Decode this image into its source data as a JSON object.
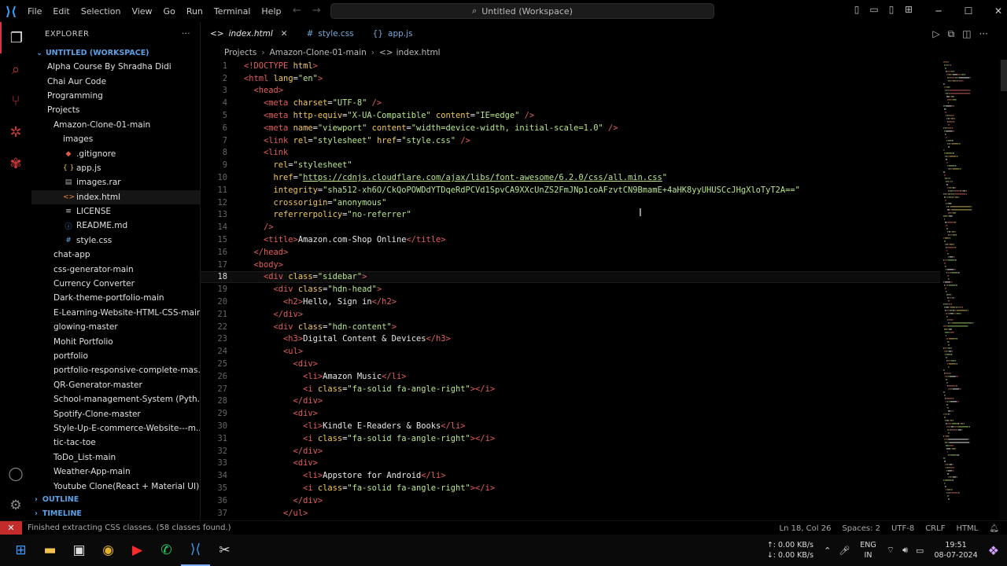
{
  "menu": [
    "File",
    "Edit",
    "Selection",
    "View",
    "Go",
    "Run",
    "Terminal",
    "Help"
  ],
  "command_center": "Untitled (Workspace)",
  "explorer": {
    "title": "EXPLORER",
    "more": "···",
    "workspace": "UNTITLED (WORKSPACE)",
    "items": [
      {
        "label": "Alpha Course By Shradha Didi",
        "indent": 20,
        "icon": "folder"
      },
      {
        "label": "Chai Aur Code",
        "indent": 20,
        "icon": "folder"
      },
      {
        "label": "Programming",
        "indent": 20,
        "icon": "folder"
      },
      {
        "label": "Projects",
        "indent": 20,
        "icon": "folder"
      },
      {
        "label": "Amazon-Clone-01-main",
        "indent": 28,
        "icon": "folder"
      },
      {
        "label": "images",
        "indent": 40,
        "icon": "folder"
      },
      {
        "label": ".gitignore",
        "indent": 40,
        "icon": "git"
      },
      {
        "label": "app.js",
        "indent": 40,
        "icon": "js"
      },
      {
        "label": "images.rar",
        "indent": 40,
        "icon": "rar"
      },
      {
        "label": "index.html",
        "indent": 40,
        "icon": "html"
      },
      {
        "label": "LICENSE",
        "indent": 40,
        "icon": "license"
      },
      {
        "label": "README.md",
        "indent": 40,
        "icon": "md"
      },
      {
        "label": "style.css",
        "indent": 40,
        "icon": "css"
      },
      {
        "label": "chat-app",
        "indent": 28,
        "icon": "folder"
      },
      {
        "label": "css-generator-main",
        "indent": 28,
        "icon": "folder"
      },
      {
        "label": "Currency Converter",
        "indent": 28,
        "icon": "folder"
      },
      {
        "label": "Dark-theme-portfolio-main",
        "indent": 28,
        "icon": "folder"
      },
      {
        "label": "E-Learning-Website-HTML-CSS-main",
        "indent": 28,
        "icon": "folder"
      },
      {
        "label": "glowing-master",
        "indent": 28,
        "icon": "folder"
      },
      {
        "label": "Mohit Portfolio",
        "indent": 28,
        "icon": "folder"
      },
      {
        "label": "portfolio",
        "indent": 28,
        "icon": "folder"
      },
      {
        "label": "portfolio-responsive-complete-mas...",
        "indent": 28,
        "icon": "folder"
      },
      {
        "label": "QR-Generator-master",
        "indent": 28,
        "icon": "folder"
      },
      {
        "label": "School-management-System (Pyth...",
        "indent": 28,
        "icon": "folder"
      },
      {
        "label": "Spotify-Clone-master",
        "indent": 28,
        "icon": "folder"
      },
      {
        "label": "Style-Up-E-commerce-Website---m...",
        "indent": 28,
        "icon": "folder"
      },
      {
        "label": "tic-tac-toe",
        "indent": 28,
        "icon": "folder"
      },
      {
        "label": "ToDo_List-main",
        "indent": 28,
        "icon": "folder"
      },
      {
        "label": "Weather-App-main",
        "indent": 28,
        "icon": "folder"
      },
      {
        "label": "Youtube Clone(React + Material UI)",
        "indent": 28,
        "icon": "folder"
      }
    ],
    "outline": "OUTLINE",
    "timeline": "TIMELINE"
  },
  "tabs": [
    {
      "label": "index.html",
      "icon": "<>",
      "active": true,
      "color": "#e8e8e8"
    },
    {
      "label": "style.css",
      "icon": "#",
      "active": false,
      "color": "#7aa9d8"
    },
    {
      "label": "app.js",
      "icon": "{}",
      "active": false,
      "color": "#7aa9d8"
    }
  ],
  "breadcrumb": [
    "Projects",
    "Amazon-Clone-01-main",
    "index.html"
  ],
  "current_line": 18,
  "code_lines": [
    [
      [
        "<!DOCTYPE ",
        "t"
      ],
      [
        "html",
        "a"
      ],
      [
        ">",
        "t"
      ]
    ],
    [
      [
        "<html ",
        "t"
      ],
      [
        "lang",
        "a"
      ],
      [
        "=",
        "x"
      ],
      [
        "\"en\"",
        "s"
      ],
      [
        ">",
        "t"
      ]
    ],
    [
      [
        "  <head>",
        "t"
      ]
    ],
    [
      [
        "    <meta ",
        "t"
      ],
      [
        "charset",
        "a"
      ],
      [
        "=",
        "x"
      ],
      [
        "\"UTF-8\"",
        "s"
      ],
      [
        " />",
        "t"
      ]
    ],
    [
      [
        "    <meta ",
        "t"
      ],
      [
        "http-equiv",
        "a"
      ],
      [
        "=",
        "x"
      ],
      [
        "\"X-UA-Compatible\"",
        "s"
      ],
      [
        " content",
        "a"
      ],
      [
        "=",
        "x"
      ],
      [
        "\"IE=edge\"",
        "s"
      ],
      [
        " />",
        "t"
      ]
    ],
    [
      [
        "    <meta ",
        "t"
      ],
      [
        "name",
        "a"
      ],
      [
        "=",
        "x"
      ],
      [
        "\"viewport\"",
        "s"
      ],
      [
        " content",
        "a"
      ],
      [
        "=",
        "x"
      ],
      [
        "\"width=device-width, initial-scale=1.0\"",
        "s"
      ],
      [
        " />",
        "t"
      ]
    ],
    [
      [
        "    <link ",
        "t"
      ],
      [
        "rel",
        "a"
      ],
      [
        "=",
        "x"
      ],
      [
        "\"stylesheet\"",
        "s"
      ],
      [
        " href",
        "a"
      ],
      [
        "=",
        "x"
      ],
      [
        "\"style.css\"",
        "s"
      ],
      [
        " />",
        "t"
      ]
    ],
    [
      [
        "    <link",
        "t"
      ]
    ],
    [
      [
        "      rel",
        "a"
      ],
      [
        "=",
        "x"
      ],
      [
        "\"stylesheet\"",
        "s"
      ]
    ],
    [
      [
        "      href",
        "a"
      ],
      [
        "=",
        "x"
      ],
      [
        "\"",
        "s"
      ],
      [
        "https://cdnjs.cloudflare.com/ajax/libs/font-awesome/6.2.0/css/all.min.css",
        "u"
      ],
      [
        "\"",
        "s"
      ]
    ],
    [
      [
        "      integrity",
        "a"
      ],
      [
        "=",
        "x"
      ],
      [
        "\"sha512-xh6O/CkQoPOWDdYTDqeRdPCVd1SpvCA9XXcUnZS2FmJNp1coAFzvtCN9BmamE+4aHK8yyUHUSCcJHgXloTyT2A==\"",
        "s"
      ]
    ],
    [
      [
        "      crossorigin",
        "a"
      ],
      [
        "=",
        "x"
      ],
      [
        "\"anonymous\"",
        "s"
      ]
    ],
    [
      [
        "      referrerpolicy",
        "a"
      ],
      [
        "=",
        "x"
      ],
      [
        "\"no-referrer\"",
        "s"
      ]
    ],
    [
      [
        "    />",
        "t"
      ]
    ],
    [
      [
        "    <title>",
        "t"
      ],
      [
        "Amazon.com-Shop Online",
        "x"
      ],
      [
        "</title>",
        "t"
      ]
    ],
    [
      [
        "  </head>",
        "t"
      ]
    ],
    [
      [
        "  <body>",
        "t"
      ]
    ],
    [
      [
        "    <div ",
        "t"
      ],
      [
        "class",
        "a"
      ],
      [
        "=",
        "x"
      ],
      [
        "\"sidebar\"",
        "s"
      ],
      [
        ">",
        "t"
      ]
    ],
    [
      [
        "      <div ",
        "t"
      ],
      [
        "class",
        "a"
      ],
      [
        "=",
        "x"
      ],
      [
        "\"hdn-head\"",
        "s"
      ],
      [
        ">",
        "t"
      ]
    ],
    [
      [
        "        <h2>",
        "t"
      ],
      [
        "Hello, Sign in",
        "x"
      ],
      [
        "</h2>",
        "t"
      ]
    ],
    [
      [
        "      </div>",
        "t"
      ]
    ],
    [
      [
        "      <div ",
        "t"
      ],
      [
        "class",
        "a"
      ],
      [
        "=",
        "x"
      ],
      [
        "\"hdn-content\"",
        "s"
      ],
      [
        ">",
        "t"
      ]
    ],
    [
      [
        "        <h3>",
        "t"
      ],
      [
        "Digital Content & Devices",
        "x"
      ],
      [
        "</h3>",
        "t"
      ]
    ],
    [
      [
        "        <ul>",
        "t"
      ]
    ],
    [
      [
        "          <div>",
        "t"
      ]
    ],
    [
      [
        "            <li>",
        "t"
      ],
      [
        "Amazon Music",
        "x"
      ],
      [
        "</li>",
        "t"
      ]
    ],
    [
      [
        "            <i ",
        "t"
      ],
      [
        "class",
        "a"
      ],
      [
        "=",
        "x"
      ],
      [
        "\"fa-solid fa-angle-right\"",
        "s"
      ],
      [
        "></i>",
        "t"
      ]
    ],
    [
      [
        "          </div>",
        "t"
      ]
    ],
    [
      [
        "          <div>",
        "t"
      ]
    ],
    [
      [
        "            <li>",
        "t"
      ],
      [
        "Kindle E-Readers & Books",
        "x"
      ],
      [
        "</li>",
        "t"
      ]
    ],
    [
      [
        "            <i ",
        "t"
      ],
      [
        "class",
        "a"
      ],
      [
        "=",
        "x"
      ],
      [
        "\"fa-solid fa-angle-right\"",
        "s"
      ],
      [
        "></i>",
        "t"
      ]
    ],
    [
      [
        "          </div>",
        "t"
      ]
    ],
    [
      [
        "          <div>",
        "t"
      ]
    ],
    [
      [
        "            <li>",
        "t"
      ],
      [
        "Appstore for Android",
        "x"
      ],
      [
        "</li>",
        "t"
      ]
    ],
    [
      [
        "            <i ",
        "t"
      ],
      [
        "class",
        "a"
      ],
      [
        "=",
        "x"
      ],
      [
        "\"fa-solid fa-angle-right\"",
        "s"
      ],
      [
        "></i>",
        "t"
      ]
    ],
    [
      [
        "          </div>",
        "t"
      ]
    ],
    [
      [
        "        </ul>",
        "t"
      ]
    ]
  ],
  "status": {
    "message": "Finished extracting CSS classes. (58 classes found.)",
    "position": "Ln 18, Col 26",
    "spaces": "Spaces: 2",
    "encoding": "UTF-8",
    "eol": "CRLF",
    "language": "HTML"
  },
  "taskbar": {
    "net_up": "↑: 0.00 KB/s",
    "net_down": "↓: 0.00 KB/s",
    "lang1": "ENG",
    "lang2": "IN",
    "time": "19:51",
    "date": "08-07-2024"
  },
  "colors": {
    "accent_red": "#c42b2b",
    "link_blue": "#5aa0e6",
    "tag": "#e45d5d",
    "attr": "#f0c85a",
    "string": "#b8e68a"
  }
}
